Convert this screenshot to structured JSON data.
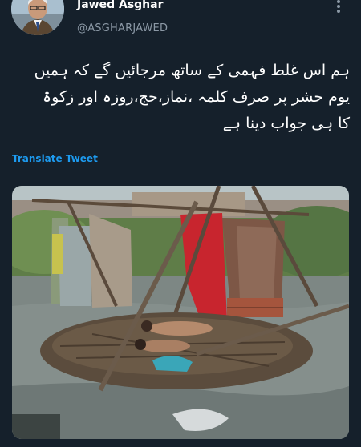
{
  "tweet": {
    "author": {
      "display_name": "Jawed Asghar",
      "handle": "@ASGHARJAWED",
      "avatar_icon": "user-avatar-photo"
    },
    "more_icon": "more-vertical-icon",
    "text_lines": [
      "ہم اس غلط فہمی کے ساتھ مرجائیں گے کہ ہمیں",
      "یوم حشر پر صرف  کلمہ ،نماز،حج،روزہ اور زکوۃ",
      "کا ہی جواب دینا ہے"
    ],
    "translate_label": "Translate Tweet",
    "media": {
      "type": "photo",
      "subject": "flood-hut-photo"
    }
  },
  "colors": {
    "background": "#15202b",
    "text": "#ffffff",
    "secondary_text": "#8b98a5",
    "accent": "#1d9bf0"
  }
}
